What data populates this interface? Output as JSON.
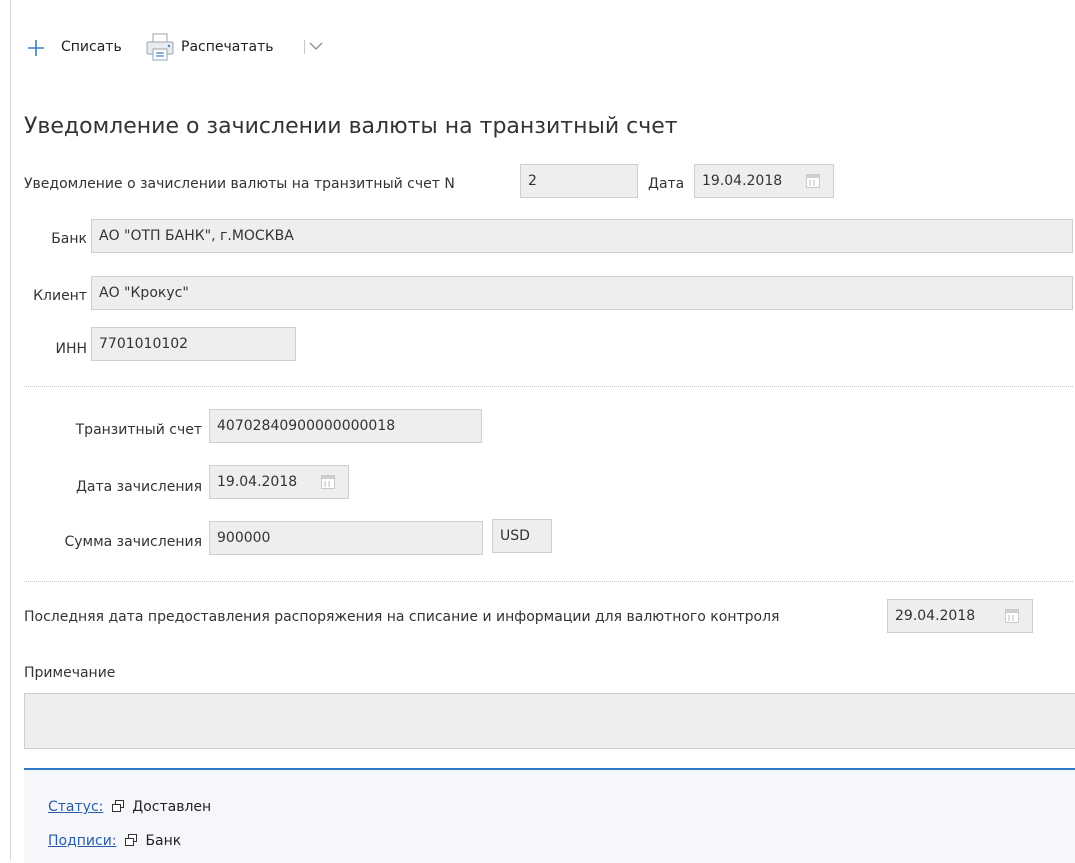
{
  "toolbar": {
    "write_off_label": "Списать",
    "print_label": "Распечатать"
  },
  "page_title": "Уведомление о зачислении валюты на транзитный счет",
  "header_fields": {
    "number_label": "Уведомление о зачислении валюты на транзитный счет N",
    "number_value": "2",
    "date_label": "Дата",
    "date_value": "19.04.2018"
  },
  "bank": {
    "label": "Банк",
    "value": "АО \"ОТП БАНК\", г.МОСКВА"
  },
  "client": {
    "label": "Клиент",
    "value": "АО \"Крокус\""
  },
  "inn": {
    "label": "ИНН",
    "value": "7701010102"
  },
  "transit_account": {
    "label": "Транзитный счет",
    "value": "40702840900000000018"
  },
  "credit_date": {
    "label": "Дата зачисления",
    "value": "19.04.2018"
  },
  "credit_amount": {
    "label": "Сумма зачисления",
    "value": "900000",
    "currency": "USD"
  },
  "last_date": {
    "label": "Последняя дата предоставления распоряжения на списание и информации для валютного контроля",
    "value": "29.04.2018"
  },
  "note": {
    "label": "Примечание",
    "value": ""
  },
  "footer": {
    "status_label": "Статус:",
    "status_value": "Доставлен",
    "signatures_label": "Подписи:",
    "signatures_value": "Банк"
  },
  "colors": {
    "accent_line": "#2d7ac7",
    "link": "#2a5fa8",
    "field_bg": "#eeeeee"
  }
}
